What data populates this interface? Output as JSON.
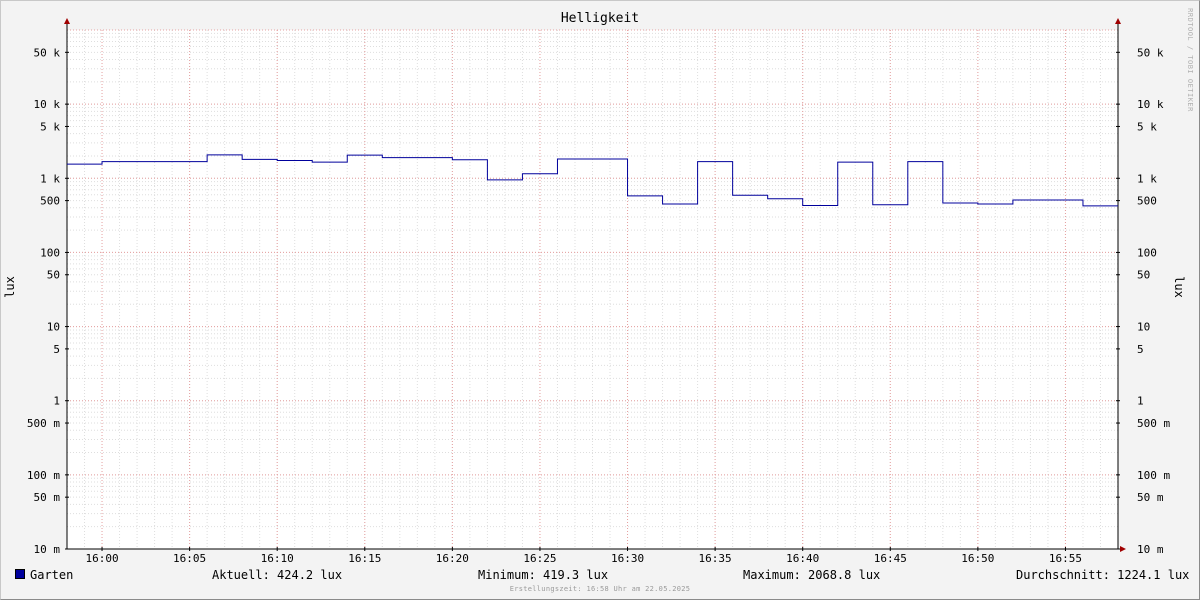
{
  "chart_data": {
    "type": "line",
    "title": "Helligkeit",
    "ylabel": "lux",
    "yscale": "log",
    "ylim": [
      0.01,
      100000
    ],
    "xlim": [
      "15:58",
      "16:58"
    ],
    "y_tick_labels": [
      {
        "value": 50000,
        "label": "50 k"
      },
      {
        "value": 10000,
        "label": "10 k"
      },
      {
        "value": 5000,
        "label": "5 k"
      },
      {
        "value": 1000,
        "label": "1 k"
      },
      {
        "value": 500,
        "label": "500"
      },
      {
        "value": 100,
        "label": "100"
      },
      {
        "value": 50,
        "label": "50"
      },
      {
        "value": 10,
        "label": "10"
      },
      {
        "value": 5,
        "label": "5"
      },
      {
        "value": 1,
        "label": "1"
      },
      {
        "value": 0.5,
        "label": "500 m"
      },
      {
        "value": 0.1,
        "label": "100 m"
      },
      {
        "value": 0.05,
        "label": "50 m"
      },
      {
        "value": 0.01,
        "label": "10 m"
      }
    ],
    "x_tick_labels": [
      "16:00",
      "16:05",
      "16:10",
      "16:15",
      "16:20",
      "16:25",
      "16:30",
      "16:35",
      "16:40",
      "16:45",
      "16:50",
      "16:55"
    ],
    "grid": true,
    "series": [
      {
        "name": "Garten",
        "color": "#00009c",
        "step": true,
        "x": [
          "15:58",
          "16:00",
          "16:06",
          "16:08",
          "16:10",
          "16:12",
          "16:14",
          "16:16",
          "16:20",
          "16:22",
          "16:24",
          "16:26",
          "16:30",
          "16:32",
          "16:34",
          "16:36",
          "16:38",
          "16:40",
          "16:42",
          "16:44",
          "16:46",
          "16:48",
          "16:50",
          "16:52",
          "16:56",
          "16:58"
        ],
        "values": [
          1550,
          1680,
          2068.8,
          1800,
          1740,
          1650,
          2050,
          1900,
          1780,
          950,
          1150,
          1820,
          580,
          450,
          1680,
          590,
          530,
          430,
          1650,
          440,
          1680,
          465,
          450,
          510,
          424.2,
          424.2
        ]
      }
    ]
  },
  "legend": {
    "series_name": "Garten",
    "current": "Aktuell: 424.2 lux",
    "minimum": "Minimum: 419.3 lux",
    "maximum": "Maximum: 2068.8 lux",
    "average": "Durchschnitt: 1224.1 lux"
  },
  "watermark": "RRDTOOL / TOBI OETIKER",
  "footer": "Erstellungszeit: 16:58 Uhr am 22.05.2025"
}
